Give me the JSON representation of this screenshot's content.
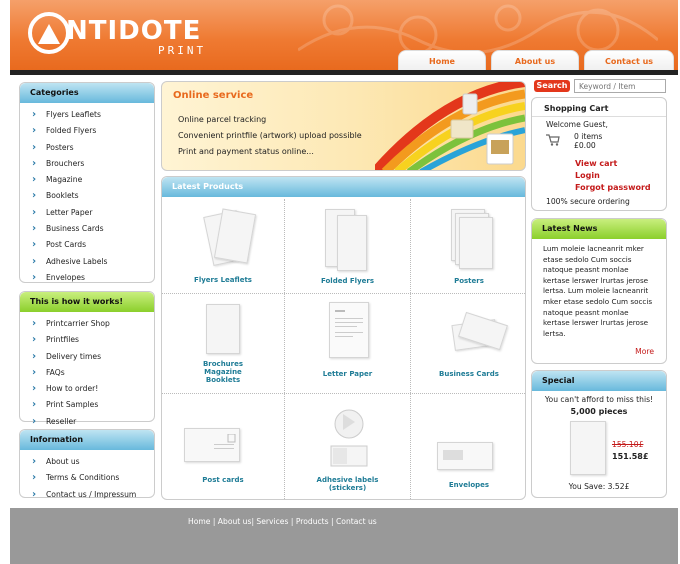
{
  "logo": {
    "main": "NTIDOTE",
    "sub": "PRINT"
  },
  "nav": [
    "Home",
    "About us",
    "Contact us"
  ],
  "categories": {
    "title": "Categories",
    "items": [
      "Flyers Leaflets",
      "Folded Flyers",
      "Posters",
      "Brouchers",
      "Magazine",
      "Booklets",
      "Letter Paper",
      "Business Cards",
      "Post Cards",
      "Adhesive Labels",
      "Envelopes"
    ]
  },
  "how": {
    "title": "This is how it works!",
    "items": [
      "Printcarrier Shop",
      "Printfiles",
      "Delivery times",
      "FAQs",
      "How to order!",
      "Print Samples",
      "Reseller"
    ]
  },
  "information": {
    "title": "Information",
    "items": [
      "About us",
      "Terms & Conditions",
      "Contact us / Impressum"
    ]
  },
  "online": {
    "title": "Online service",
    "lines": [
      "Online parcel tracking",
      "Convenient printfile (artwork) upload possible",
      "Print and payment status online..."
    ]
  },
  "latest_products": {
    "title": "Latest Products",
    "items": [
      {
        "label": "Flyers Leaflets"
      },
      {
        "label": "Folded Flyers"
      },
      {
        "label": "Posters"
      },
      {
        "label": "Brochures Magazine Booklets",
        "lines": [
          "Brochures",
          "Magazine",
          "Booklets"
        ]
      },
      {
        "label": "Letter Paper"
      },
      {
        "label": "Business Cards"
      },
      {
        "label": "Post cards"
      },
      {
        "label": "Adhesive labels (stickers)",
        "lines": [
          "Adhesive labels",
          "(stickers)"
        ]
      },
      {
        "label": "Envelopes"
      }
    ]
  },
  "search": {
    "button": "Search",
    "placeholder": "Keyword / Item"
  },
  "cart": {
    "title": "Shopping Cart",
    "welcome": "Welcome Guest,",
    "items": "0 items",
    "amount": "£0.00",
    "view": "View cart",
    "login": "Login",
    "forgot": "Forgot password",
    "secure": "100% secure ordering"
  },
  "news": {
    "title": "Latest News",
    "lines": [
      "Lum moleie lacneanrit mker",
      "etase sedolo Cum soccis",
      "natoque peasnt monlae",
      "kertase lerswer lrurtas jerose",
      "lertsa. Lum moleie lacneanrit",
      "mker etase sedolo Cum soccis",
      "natoque peasnt monlae",
      "kertase lerswer lrurtas jerose",
      "lertsa."
    ],
    "more": "More"
  },
  "special": {
    "title": "Special",
    "tagline": "You can't afford to miss this!",
    "pieces": "5,000 pieces",
    "old_price": "155.10£",
    "new_price": "151.58£",
    "save": "You Save: 3.52£"
  },
  "footer": {
    "links": "Home | About us| Services | Products | Contact us"
  },
  "colors": {
    "orange": "#e8691d",
    "blue_header": "#68b9dc",
    "green_header": "#8bcf2c",
    "red": "#c41a1a",
    "teal_label": "#1f7c96"
  }
}
